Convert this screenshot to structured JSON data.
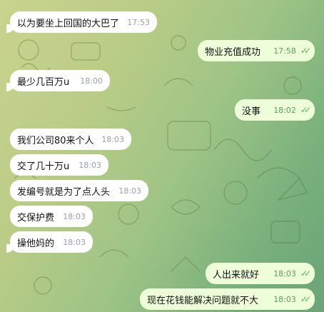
{
  "colors": {
    "incoming_bubble": "#ffffff",
    "outgoing_bubble": "#eefed9",
    "tick": "#5ab05a"
  },
  "messages": [
    {
      "text": "以为要坐上回国的大巴了",
      "time": "17:53",
      "dir": "in"
    },
    {
      "text": "物业充值成功",
      "time": "17:58",
      "dir": "out",
      "status": "read"
    },
    {
      "text": "最少几百万u",
      "time": "18:00",
      "dir": "in"
    },
    {
      "text": "没事",
      "time": "18:02",
      "dir": "out",
      "status": "read"
    },
    {
      "text": "我们公司80来个人",
      "time": "18:03",
      "dir": "in"
    },
    {
      "text": "交了几十万u",
      "time": "18:03",
      "dir": "in"
    },
    {
      "text": "发编号就是为了点人头",
      "time": "18:03",
      "dir": "in"
    },
    {
      "text": "交保护费",
      "time": "18:03",
      "dir": "in"
    },
    {
      "text": "操他妈的",
      "time": "18:03",
      "dir": "in"
    },
    {
      "text": "人出来就好",
      "time": "18:03",
      "dir": "out",
      "status": "read"
    },
    {
      "text": "现在花钱能解决问题就不大",
      "time": "18:03",
      "dir": "out",
      "status": "read"
    }
  ],
  "tick_icon": "✓✓"
}
